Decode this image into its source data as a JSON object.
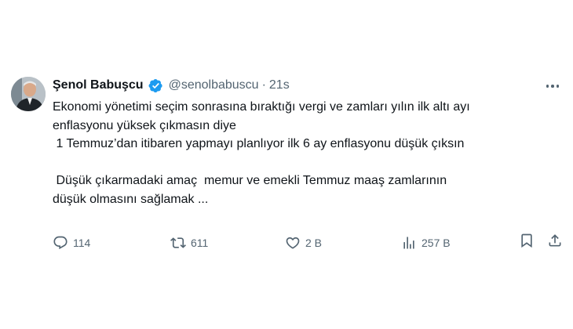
{
  "author": {
    "display_name": "Şenol Babuşcu",
    "handle": "@senolbabuscu",
    "separator": "·",
    "time": "21s"
  },
  "tweet_lines": [
    "Ekonomi yönetimi seçim sonrasına bıraktığı vergi ve zamları yılın ilk altı ayı",
    "enflasyonu yüksek çıkmasın diye",
    " 1 Temmuz’dan itibaren yapmayı planlıyor ilk 6 ay enflasyonu düşük çıksın",
    "",
    " Düşük çıkarmadaki amaç  memur ve emekli Temmuz maaş zamlarının",
    "düşük olmasını sağlamak ..."
  ],
  "actions": {
    "replies": "114",
    "retweets": "611",
    "likes": "2 B",
    "views": "257 B"
  },
  "colors": {
    "text": "#0f1419",
    "secondary": "#536471",
    "verified": "#1d9bf0"
  },
  "icons": [
    "verified-badge-icon",
    "more-icon",
    "reply-icon",
    "retweet-icon",
    "like-icon",
    "views-icon",
    "bookmark-icon",
    "share-icon"
  ]
}
